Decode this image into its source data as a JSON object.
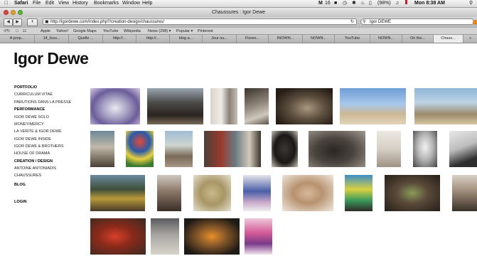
{
  "menubar": {
    "app": "Safari",
    "items": [
      "File",
      "Edit",
      "View",
      "History",
      "Bookmarks",
      "Window",
      "Help"
    ],
    "status_number": "16",
    "battery": "(98%)",
    "clock": "Mon 8:38 AM"
  },
  "window": {
    "title": "Chaussures : Igor Dewe"
  },
  "toolbar": {
    "back_label": "◀",
    "forward_label": "▶",
    "add_label": "+",
    "url": "http://igordewe.com/index.php?/creation-design/chaussures/",
    "search_value": "Igor DEWE"
  },
  "bookmarks": [
    "Apple",
    "Yahoo!",
    "Google Maps",
    "YouTube",
    "Wikipedia",
    "News (298) ▾",
    "Popular ▾",
    "Pinterest"
  ],
  "tabs": [
    "A prop...",
    "14_Issu...",
    "Quelle ...",
    "http://...",
    "http://...",
    "blog a...",
    "Jour ou...",
    "Floren...",
    "INOWN...",
    "NOWN...",
    "YouTube",
    "NOWN...",
    "On the...",
    "Chaus..."
  ],
  "tabs_overflow": "»",
  "site": {
    "logo": "Igor Dewe",
    "nav": [
      {
        "label": "PORTFOLIO",
        "bold": true
      },
      {
        "label": "CURRICULUM VITAE",
        "bold": false
      },
      {
        "label": "PARUTIONS DANS LA PRESSE",
        "bold": false
      },
      {
        "label": "PERFORMANCE",
        "bold": true
      },
      {
        "label": "IGOR DEWE SOLO",
        "bold": false
      },
      {
        "label": "MONEY/MERCY",
        "bold": false
      },
      {
        "label": "LA VERITE & IGOR DEWE",
        "bold": false
      },
      {
        "label": "IGOR DEWE INSIDE",
        "bold": false
      },
      {
        "label": "IGOR DEWE & BROTHERS",
        "bold": false
      },
      {
        "label": "HOUSE OF DRAMA",
        "bold": false
      },
      {
        "label": "CREATION / DESIGN",
        "bold": true
      },
      {
        "label": "ANTOINE ANTONIADIS",
        "bold": false
      },
      {
        "label": "CHAUSSURES",
        "bold": false
      },
      {
        "label": "BLOG",
        "bold": true
      },
      {
        "label": "LOGIN",
        "bold": true
      }
    ]
  },
  "colors": {
    "menubar_bg": "#e4e4e4",
    "tab_active": "#ececec",
    "page_bg": "#ffffff",
    "text": "#111111"
  }
}
